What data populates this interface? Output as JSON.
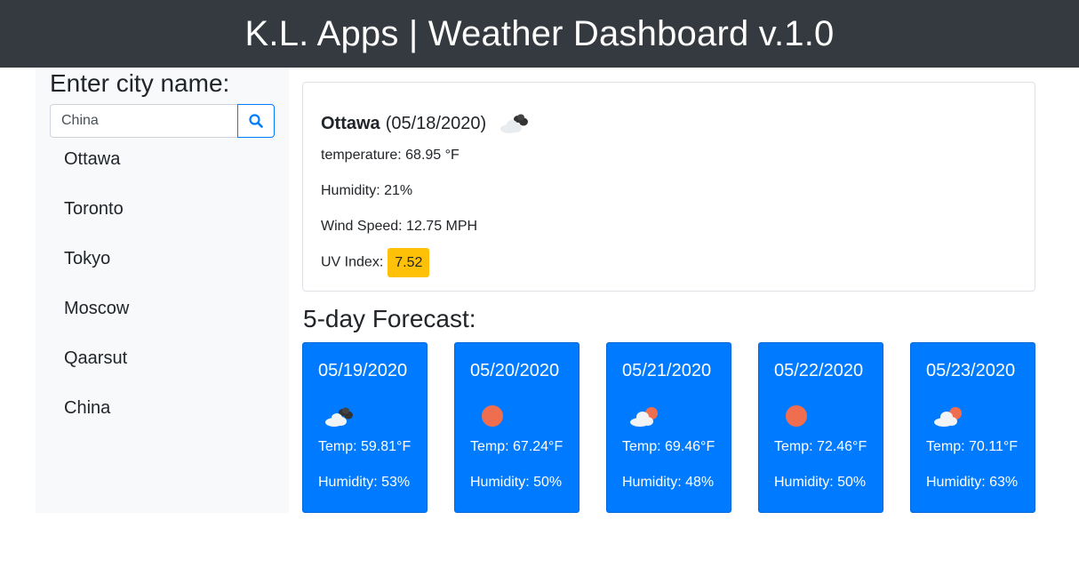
{
  "header": {
    "title": "K.L. Apps | Weather Dashboard v.1.0"
  },
  "sidebar": {
    "title": "Enter city name:",
    "search": {
      "value": "China"
    },
    "cities": [
      "Ottawa",
      "Toronto",
      "Tokyo",
      "Moscow",
      "Qaarsut",
      "China"
    ]
  },
  "current": {
    "city": "Ottawa",
    "date": "(05/18/2020)",
    "icon": "broken-clouds-icon",
    "temperature": "temperature: 68.95 °F",
    "humidity": "Humidity: 21%",
    "wind": "Wind Speed: 12.75 MPH",
    "uv_label": "UV Index:",
    "uv_value": "7.52",
    "uv_color": "#ffc107"
  },
  "forecast": {
    "title": "5-day Forecast:",
    "days": [
      {
        "date": "05/19/2020",
        "icon": "broken-clouds-icon",
        "temp": "Temp: 59.81°F",
        "humidity": "Humidity: 53%"
      },
      {
        "date": "05/20/2020",
        "icon": "clear-sun-icon",
        "temp": "Temp: 67.24°F",
        "humidity": "Humidity: 50%"
      },
      {
        "date": "05/21/2020",
        "icon": "few-clouds-icon",
        "temp": "Temp: 69.46°F",
        "humidity": "Humidity: 48%"
      },
      {
        "date": "05/22/2020",
        "icon": "clear-sun-icon",
        "temp": "Temp: 72.46°F",
        "humidity": "Humidity: 50%"
      },
      {
        "date": "05/23/2020",
        "icon": "few-clouds-icon",
        "temp": "Temp: 70.11°F",
        "humidity": "Humidity: 63%"
      }
    ]
  },
  "colors": {
    "header_bg": "#343a40",
    "card_blue": "#007bff",
    "sidebar_bg": "#f8f9fa",
    "sun": "#ee6e4f"
  }
}
